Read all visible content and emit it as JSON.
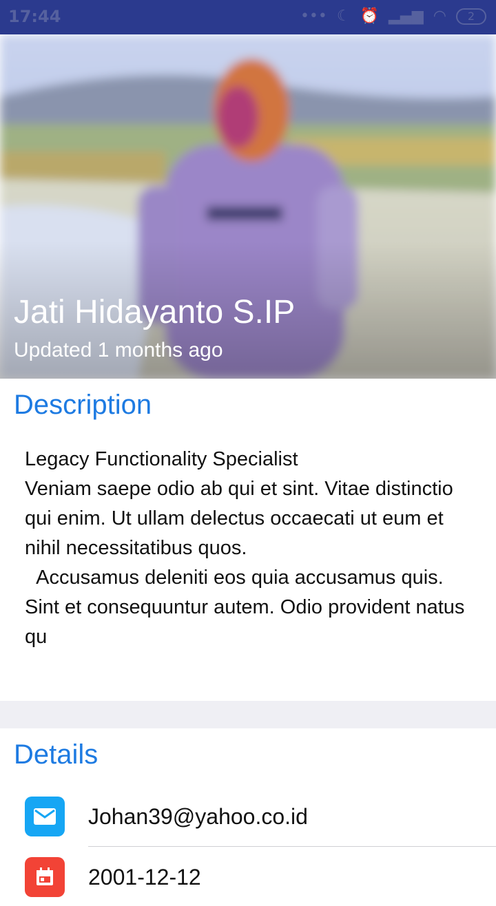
{
  "status_bar": {
    "time": "17:44",
    "battery": "2"
  },
  "profile": {
    "name": "Jati Hidayanto S.IP",
    "updated": "Updated 1 months ago"
  },
  "description": {
    "title": "Description",
    "text": "Legacy Functionality Specialist\nVeniam saepe odio ab qui et sint. Vitae distinctio qui enim. Ut ullam delectus occaecati ut eum et nihil necessitatibus quos.\n  Accusamus deleniti eos quia accusamus quis. Sint et consequuntur autem. Odio provident natus qu"
  },
  "details": {
    "title": "Details",
    "email": "Johan39@yahoo.co.id",
    "date": "2001-12-12"
  },
  "colors": {
    "accent": "#1e7be2",
    "email_icon_bg": "#16a6f4",
    "date_icon_bg": "#f24336",
    "status_bar": "#2b3a8e"
  },
  "icons": {
    "email": "mail-icon",
    "date": "calendar-icon"
  }
}
